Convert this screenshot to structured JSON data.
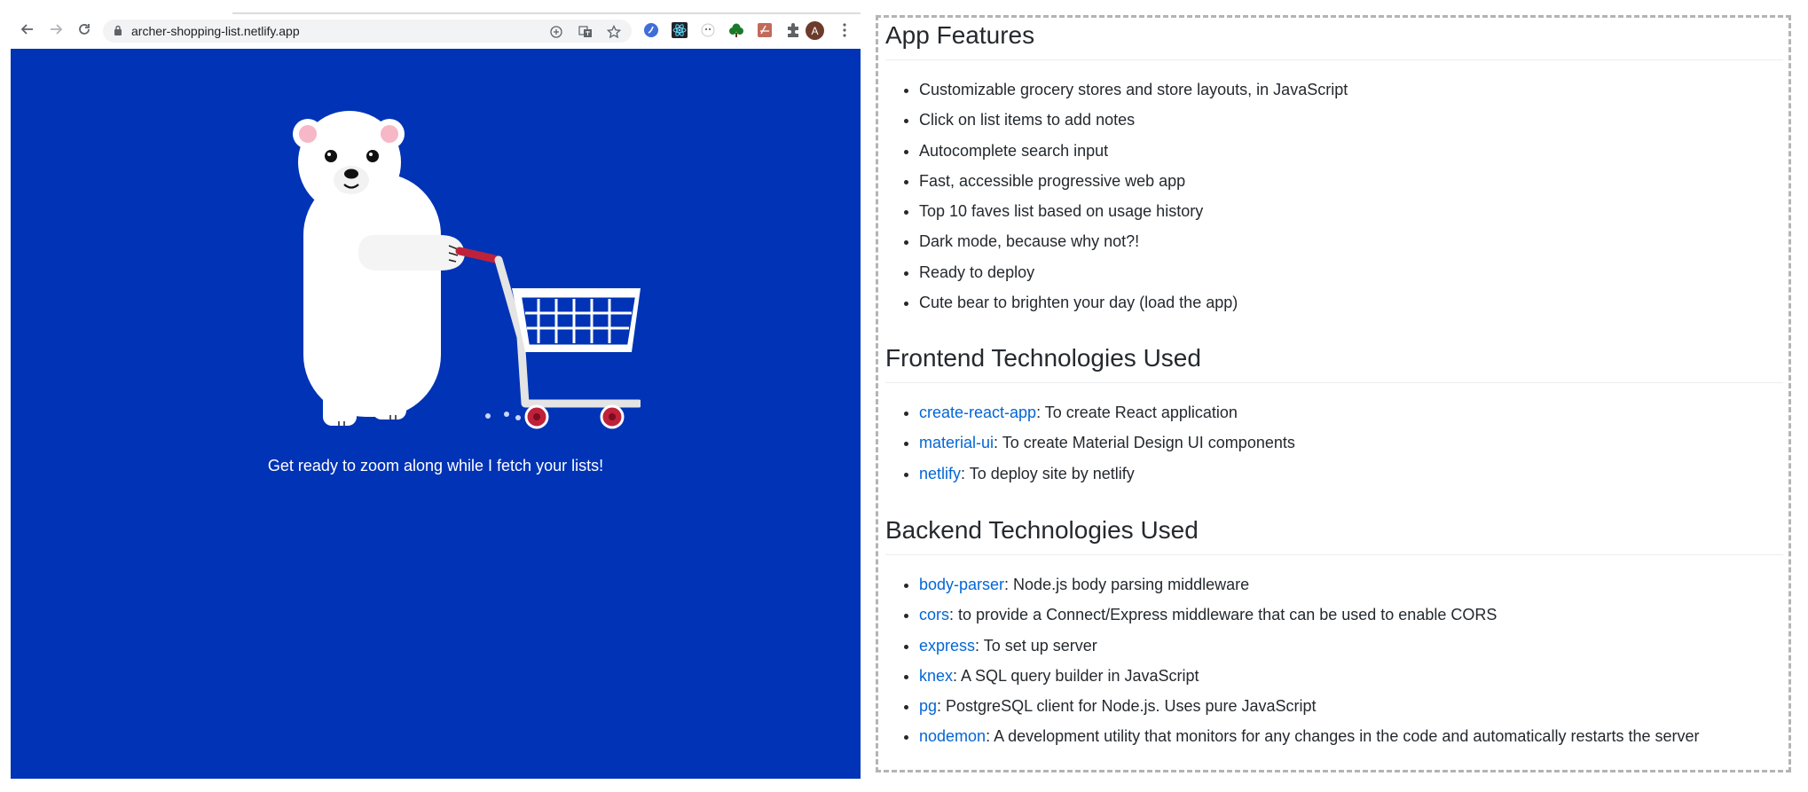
{
  "browser": {
    "url": "archer-shopping-list.netlify.app",
    "avatar_letter": "A",
    "toolbar_icons": [
      "back-arrow-icon",
      "forward-arrow-icon",
      "reload-icon",
      "lock-icon",
      "add-icon",
      "translate-icon",
      "star-icon"
    ],
    "extension_icons": [
      "extension-blue-icon",
      "react-devtools-icon",
      "extension-white-icon",
      "tree-icon",
      "pdf-icon",
      "puzzle-icon"
    ]
  },
  "app": {
    "background_color": "#0033b5",
    "loading_message": "Get ready to zoom along while I fetch your lists!",
    "illustration": "polar-bear-with-shopping-cart"
  },
  "readme": {
    "features": {
      "heading": "App Features",
      "items": [
        "Customizable grocery stores and store layouts, in JavaScript",
        "Click on list items to add notes",
        "Autocomplete search input",
        "Fast, accessible progressive web app",
        "Top 10 faves list based on usage history",
        "Dark mode, because why not?!",
        "Ready to deploy",
        "Cute bear to brighten your day (load the app)"
      ]
    },
    "frontend": {
      "heading": "Frontend Technologies Used",
      "items": [
        {
          "link": "create-react-app",
          "text": ": To create React application"
        },
        {
          "link": "material-ui",
          "text": ": To create Material Design UI components"
        },
        {
          "link": "netlify",
          "text": ": To deploy site by netlify"
        }
      ]
    },
    "backend": {
      "heading": "Backend Technologies Used",
      "items": [
        {
          "link": "body-parser",
          "text": ": Node.js body parsing middleware"
        },
        {
          "link": "cors",
          "text": ": to provide a Connect/Express middleware that can be used to enable CORS"
        },
        {
          "link": "express",
          "text": ": To set up server"
        },
        {
          "link": "knex",
          "text": ": A SQL query builder in JavaScript"
        },
        {
          "link": "pg",
          "text": ": PostgreSQL client for Node.js. Uses pure JavaScript"
        },
        {
          "link": "nodemon",
          "text": ": A development utility that monitors for any changes in the code and automatically restarts the server"
        }
      ]
    }
  }
}
